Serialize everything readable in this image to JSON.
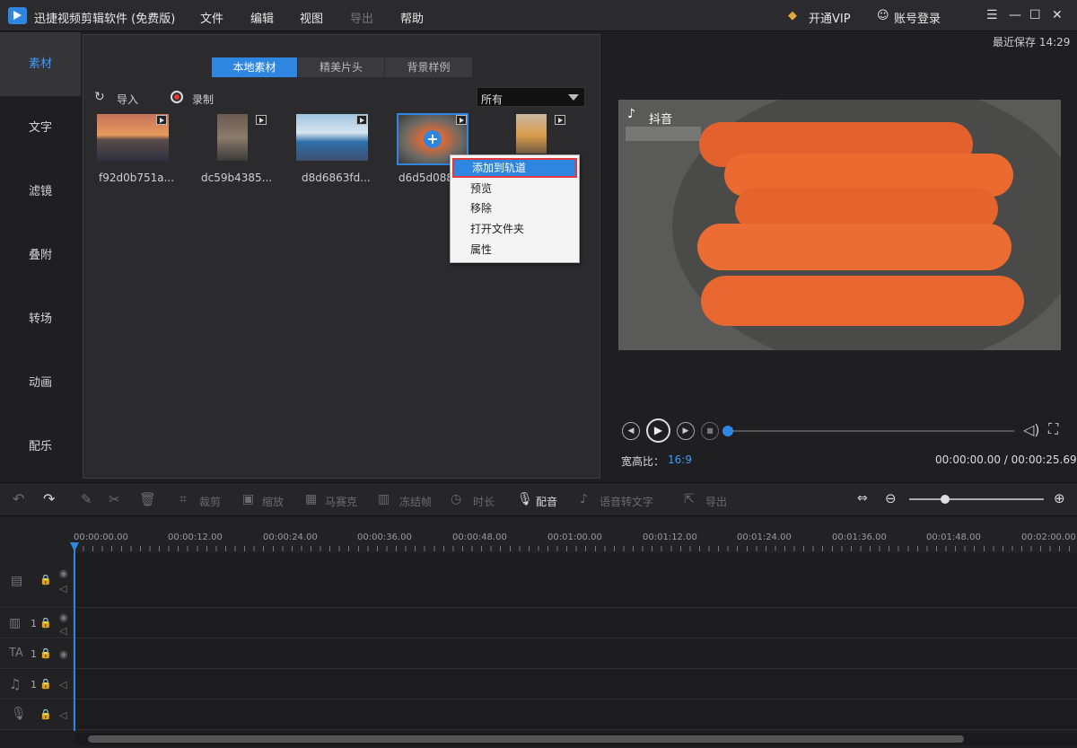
{
  "app": {
    "title": "迅捷视频剪辑软件 (免费版)",
    "menu": [
      "文件",
      "编辑",
      "视图",
      "导出",
      "帮助"
    ],
    "vip": "开通VIP",
    "account": "账号登录",
    "window_controls": [
      "menu-icon",
      "minimize-icon",
      "maximize-icon",
      "close-icon"
    ]
  },
  "sidebar": {
    "items": [
      "素材",
      "文字",
      "滤镜",
      "叠附",
      "转场",
      "动画",
      "配乐"
    ]
  },
  "media": {
    "tabs": [
      "本地素材",
      "精美片头",
      "背景样例"
    ],
    "import": "导入",
    "record": "录制",
    "filter": "所有",
    "items": [
      "f92d0b751a...",
      "dc59b4385...",
      "d8d6863fd...",
      "d6d5d088",
      "",
      ""
    ]
  },
  "context_menu": {
    "items": [
      "添加到轨道",
      "预览",
      "移除",
      "打开文件夹",
      "属性"
    ]
  },
  "preview": {
    "last_save": "最近保存 14:29",
    "watermark": "抖音",
    "aspect_label": "宽高比：",
    "aspect_value": "16:9",
    "time": "00:00:00.00 / 00:00:25.69",
    "progress": 0
  },
  "toolbar": {
    "crop": "裁剪",
    "zoom": "缩放",
    "mosaic": "马赛克",
    "freeze": "冻结帧",
    "duration": "时长",
    "dub": "配音",
    "speech": "语音转文字",
    "export": "导出"
  },
  "timeline": {
    "ticks": [
      "00:00:00.00",
      "00:00:12.00",
      "00:00:24.00",
      "00:00:36.00",
      "00:00:48.00",
      "00:01:00.00",
      "00:01:12.00",
      "00:01:24.00",
      "00:01:36.00",
      "00:01:48.00",
      "00:02:00.00"
    ],
    "track_numbers": [
      "1",
      "1",
      "1"
    ]
  },
  "colors": {
    "accent": "#2f86e0",
    "highlight_border": "#e23a3a"
  }
}
